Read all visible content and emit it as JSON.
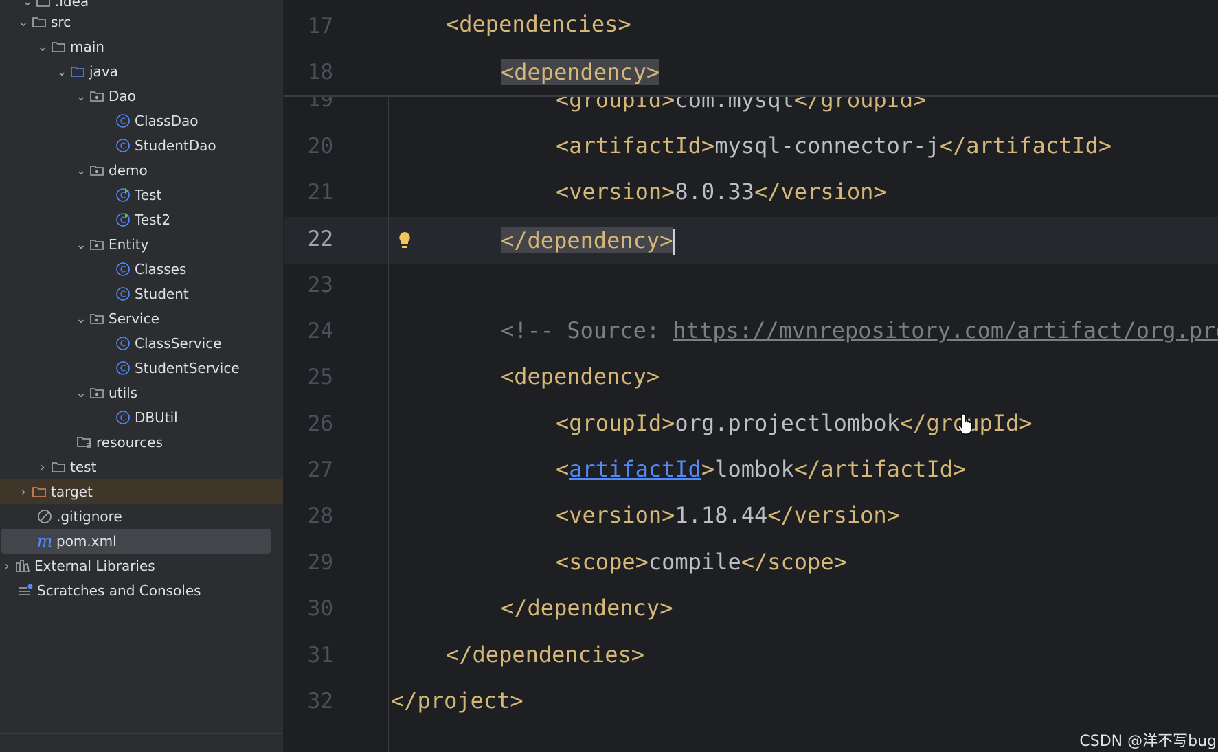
{
  "tree": {
    "rows": [
      {
        "label": ".idea",
        "icon": "folder-icon",
        "chev": "down"
      },
      {
        "label": "src",
        "icon": "folder-icon",
        "chev": "down"
      },
      {
        "label": "main",
        "icon": "folder-icon",
        "chev": "down"
      },
      {
        "label": "java",
        "icon": "source-folder-icon",
        "chev": "down"
      },
      {
        "label": "Dao",
        "icon": "package-icon",
        "chev": "down"
      },
      {
        "label": "ClassDao",
        "icon": "class-icon",
        "chev": ""
      },
      {
        "label": "StudentDao",
        "icon": "class-icon",
        "chev": ""
      },
      {
        "label": "demo",
        "icon": "package-icon",
        "chev": "down"
      },
      {
        "label": "Test",
        "icon": "runnable-class-icon",
        "chev": ""
      },
      {
        "label": "Test2",
        "icon": "runnable-class-icon",
        "chev": ""
      },
      {
        "label": "Entity",
        "icon": "package-icon",
        "chev": "down"
      },
      {
        "label": "Classes",
        "icon": "class-icon",
        "chev": ""
      },
      {
        "label": "Student",
        "icon": "class-icon",
        "chev": ""
      },
      {
        "label": "Service",
        "icon": "package-icon",
        "chev": "down"
      },
      {
        "label": "ClassService",
        "icon": "class-icon",
        "chev": ""
      },
      {
        "label": "StudentService",
        "icon": "class-icon",
        "chev": ""
      },
      {
        "label": "utils",
        "icon": "package-icon",
        "chev": "down"
      },
      {
        "label": "DBUtil",
        "icon": "class-icon",
        "chev": ""
      },
      {
        "label": "resources",
        "icon": "resources-folder-icon",
        "chev": ""
      },
      {
        "label": "test",
        "icon": "folder-icon",
        "chev": "right"
      },
      {
        "label": "target",
        "icon": "excluded-folder-icon",
        "chev": "right"
      },
      {
        "label": ".gitignore",
        "icon": "ignore-file-icon",
        "chev": ""
      },
      {
        "label": "pom.xml",
        "icon": "maven-file-icon",
        "chev": ""
      },
      {
        "label": "External Libraries",
        "icon": "libraries-icon",
        "chev": "right"
      },
      {
        "label": "Scratches and Consoles",
        "icon": "scratches-icon",
        "chev": ""
      }
    ]
  },
  "editor": {
    "sticky": {
      "l17": {
        "num": "17",
        "open": "<dependencies>"
      },
      "l18": {
        "num": "18",
        "open": "<dependency>"
      }
    },
    "lines": {
      "l19": {
        "num": "19",
        "open": "<groupId>",
        "text": "com.mysql",
        "close": "</groupId>"
      },
      "l20": {
        "num": "20",
        "open": "<artifactId>",
        "text": "mysql-connector-j",
        "close": "</artifactId>"
      },
      "l21": {
        "num": "21",
        "open": "<version>",
        "text": "8.0.33",
        "close": "</version>"
      },
      "l22": {
        "num": "22",
        "close": "</dependency>"
      },
      "l23": {
        "num": "23"
      },
      "l24": {
        "num": "24",
        "comment": "<!-- Source: ",
        "url": "https://mvnrepository.com/artifact/org.projectlombok/lombok"
      },
      "l25": {
        "num": "25",
        "open": "<dependency>"
      },
      "l26": {
        "num": "26",
        "open": "<groupId>",
        "text": "org.projectlombok",
        "close": "</groupId>"
      },
      "l27": {
        "num": "27",
        "lt": "<",
        "name": "artifactId",
        "gt": ">",
        "text": "lombok",
        "close": "</artifactId>"
      },
      "l28": {
        "num": "28",
        "open": "<version>",
        "text": "1.18.44",
        "close": "</version>"
      },
      "l29": {
        "num": "29",
        "open": "<scope>",
        "text": "compile",
        "close": "</scope>"
      },
      "l30": {
        "num": "30",
        "close": "</dependency>"
      },
      "l31": {
        "num": "31",
        "close": "</dependencies>"
      },
      "l32": {
        "num": "32",
        "close": "</project>"
      }
    }
  },
  "watermark": "CSDN @洋不写bug",
  "colors": {
    "tag": "#d5b778",
    "text": "#bcbec4",
    "comment": "#7a7e85",
    "link": "#548af7",
    "background": "#1e1f22",
    "sidebar": "#2b2d30"
  }
}
